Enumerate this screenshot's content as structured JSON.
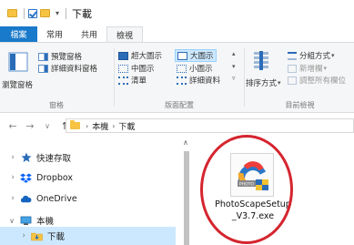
{
  "window": {
    "title": "下載"
  },
  "tabs": [
    {
      "label": "檔案"
    },
    {
      "label": "常用"
    },
    {
      "label": "共用"
    },
    {
      "label": "檢視"
    }
  ],
  "ribbon": {
    "navpane_label": "瀏覽窗格",
    "preview_pane": "預覽窗格",
    "details_pane": "詳細資料窗格",
    "group_panes": "窗格",
    "layout": {
      "extra_large": "超大圖示",
      "large": "大圖示",
      "medium": "中圖示",
      "small": "小圖示",
      "list": "清單",
      "details": "詳細資料"
    },
    "group_layout": "版面配置",
    "sort_by": "排序方式",
    "group_by": "分組方式",
    "add_columns": "新增欄",
    "size_columns": "調整所有欄位",
    "group_view": "目前檢視"
  },
  "address": {
    "crumbs": [
      "本機",
      "下載"
    ]
  },
  "nav": {
    "items": [
      {
        "label": "快速存取"
      },
      {
        "label": "Dropbox"
      },
      {
        "label": "OneDrive"
      },
      {
        "label": "本機"
      },
      {
        "label": "下載"
      }
    ]
  },
  "files": [
    {
      "name": "PhotoScapeSetup_V3.7.exe",
      "icon": "photoscape-installer-icon"
    }
  ],
  "colors": {
    "accent": "#1979ca",
    "highlight": "#cce8ff",
    "annotation_ring": "#d5252f",
    "folder": "#f6c342"
  }
}
